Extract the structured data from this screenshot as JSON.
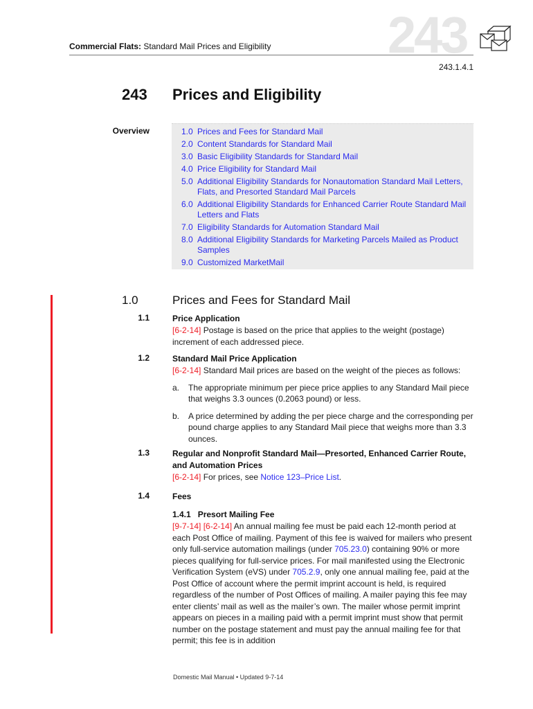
{
  "header": {
    "running_head_bold": "Commercial Flats:",
    "running_head_rest": " Standard Mail Prices and Eligibility",
    "big_number": "243",
    "icon": "mail-parcel-icon",
    "section_ref": "243.1.4.1"
  },
  "chapter": {
    "number": "243",
    "title": "Prices and Eligibility"
  },
  "overview": {
    "label": "Overview",
    "items": [
      {
        "num": "1.0",
        "text": "Prices and Fees for Standard Mail"
      },
      {
        "num": "2.0",
        "text": "Content Standards for Standard Mail"
      },
      {
        "num": "3.0",
        "text": "Basic Eligibility Standards for Standard Mail"
      },
      {
        "num": "4.0",
        "text": "Price Eligibility for Standard Mail"
      },
      {
        "num": "5.0",
        "text": "Additional Eligibility Standards for Nonautomation Standard Mail Letters, Flats, and Presorted Standard Mail Parcels"
      },
      {
        "num": "6.0",
        "text": "Additional Eligibility Standards for Enhanced Carrier Route Standard Mail Letters and Flats"
      },
      {
        "num": "7.0",
        "text": "Eligibility Standards for Automation Standard Mail"
      },
      {
        "num": "8.0",
        "text": "Additional Eligibility Standards for Marketing Parcels Mailed as Product Samples"
      },
      {
        "num": "9.0",
        "text": "Customized MarketMail"
      }
    ]
  },
  "section1": {
    "number": "1.0",
    "title": "Prices and Fees for Standard Mail",
    "s1_1": {
      "number": "1.1",
      "title": "Price Application",
      "date": "[6-2-14]",
      "text": " Postage is based on the price that applies to the weight (postage) increment of each addressed piece."
    },
    "s1_2": {
      "number": "1.2",
      "title": "Standard Mail Price Application",
      "date": "[6-2-14]",
      "text": " Standard Mail prices are based on the weight of the pieces as follows:",
      "items": [
        {
          "mark": "a.",
          "text": "The appropriate minimum per piece price applies to any Standard Mail piece that weighs 3.3 ounces (0.2063 pound) or less."
        },
        {
          "mark": "b.",
          "text": "A price determined by adding the per piece charge and the corresponding per pound charge applies to any Standard Mail piece that weighs more than 3.3 ounces."
        }
      ]
    },
    "s1_3": {
      "number": "1.3",
      "title": "Regular and Nonprofit Standard Mail—Presorted, Enhanced Carrier Route, and Automation Prices",
      "date": "[6-2-14]",
      "text_before": " For prices, see ",
      "link": "Notice 123–Price List",
      "text_after": "."
    },
    "s1_4": {
      "number": "1.4",
      "title": "Fees",
      "s1_4_1": {
        "title": "1.4.1   Presort Mailing Fee",
        "date1": "[9-7-14]",
        "date2": "[6-2-14]",
        "t1": " An annual mailing fee must be paid each 12-month period at each Post Office of mailing. Payment of this fee is waived for mailers who present only full-service automation mailings (under ",
        "link1": "705.23.0",
        "t2": ") containing 90% or more pieces qualifying for full-service prices. For mail manifested using the Electronic Verification System (eVS) under ",
        "link2": "705.2.9",
        "t3": ", only one annual mailing fee, paid at the Post Office of account where the permit imprint account is held, is required regardless of the number of Post Offices of mailing. A mailer paying this fee may enter clients’ mail as well as the mailer’s own. The mailer whose permit imprint appears on pieces in a mailing paid with a permit imprint must show that permit number on the postage statement and must pay the annual mailing fee for that permit; this fee is in addition"
      }
    }
  },
  "footer": {
    "text": "Domestic Mail Manual • Updated 9-7-14"
  },
  "colors": {
    "link": "#2a2aee",
    "date": "#ee1c25",
    "change_bar": "#ee1c25",
    "toc_bg": "#ebebeb"
  }
}
